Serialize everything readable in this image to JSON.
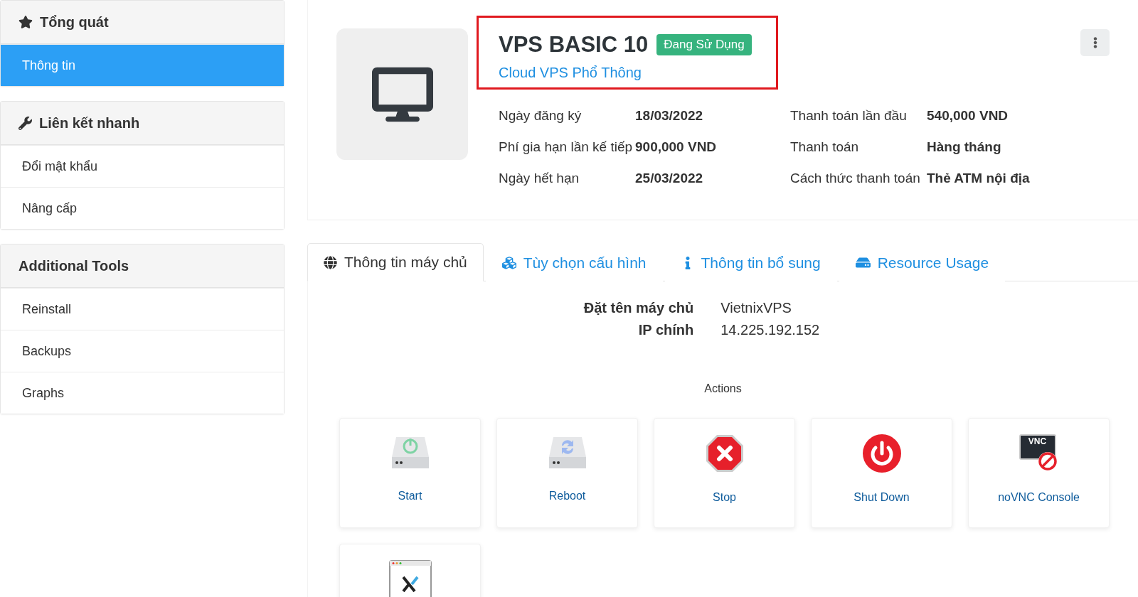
{
  "sidebar": {
    "sections": [
      {
        "title": "Tổng quát",
        "kind": "star",
        "items": [
          {
            "label": "Thông tin",
            "selected": true
          }
        ]
      },
      {
        "title": "Liên kết nhanh",
        "kind": "wrench",
        "items": [
          {
            "label": "Đổi mật khẩu",
            "selected": false
          },
          {
            "label": "Nâng cấp",
            "selected": false
          }
        ]
      },
      {
        "title": "Additional Tools",
        "kind": "plain",
        "items": [
          {
            "label": "Reinstall",
            "selected": false
          },
          {
            "label": "Backups",
            "selected": false
          },
          {
            "label": "Graphs",
            "selected": false
          }
        ]
      }
    ]
  },
  "product": {
    "name": "VPS BASIC 10",
    "status": "Đang Sử Dụng",
    "group": "Cloud VPS Phổ Thông",
    "highlighted": true,
    "details": [
      {
        "label": "Ngày đăng ký",
        "value": "18/03/2022"
      },
      {
        "label": "Thanh toán lần đầu",
        "value": "540,000 VND"
      },
      {
        "label": "Phí gia hạn lần kế tiếp",
        "value": "900,000 VND"
      },
      {
        "label": "Thanh toán",
        "value": "Hàng tháng"
      },
      {
        "label": "Ngày hết hạn",
        "value": "25/03/2022"
      },
      {
        "label": "Cách thức thanh toán",
        "value": "Thẻ ATM nội địa"
      }
    ]
  },
  "tabs": [
    {
      "label": "Thông tin máy chủ",
      "kind": "globe",
      "selected": true
    },
    {
      "label": "Tùy chọn cấu hình",
      "kind": "cubes",
      "selected": false
    },
    {
      "label": "Thông tin bổ sung",
      "kind": "info",
      "selected": false
    },
    {
      "label": "Resource Usage",
      "kind": "drive",
      "selected": false
    }
  ],
  "server_info": [
    {
      "label": "Đặt tên máy chủ",
      "value": "VietnixVPS"
    },
    {
      "label": "IP chính",
      "value": "14.225.192.152"
    }
  ],
  "actions_title": "Actions",
  "actions": [
    {
      "kind": "start",
      "label": "Start"
    },
    {
      "kind": "reboot",
      "label": "Reboot"
    },
    {
      "kind": "stop",
      "label": "Stop"
    },
    {
      "kind": "shutdown",
      "label": "Shut Down"
    },
    {
      "kind": "vnc",
      "label": "noVNC Console",
      "icon_text": "VNC"
    },
    {
      "kind": "xconsole"
    }
  ]
}
